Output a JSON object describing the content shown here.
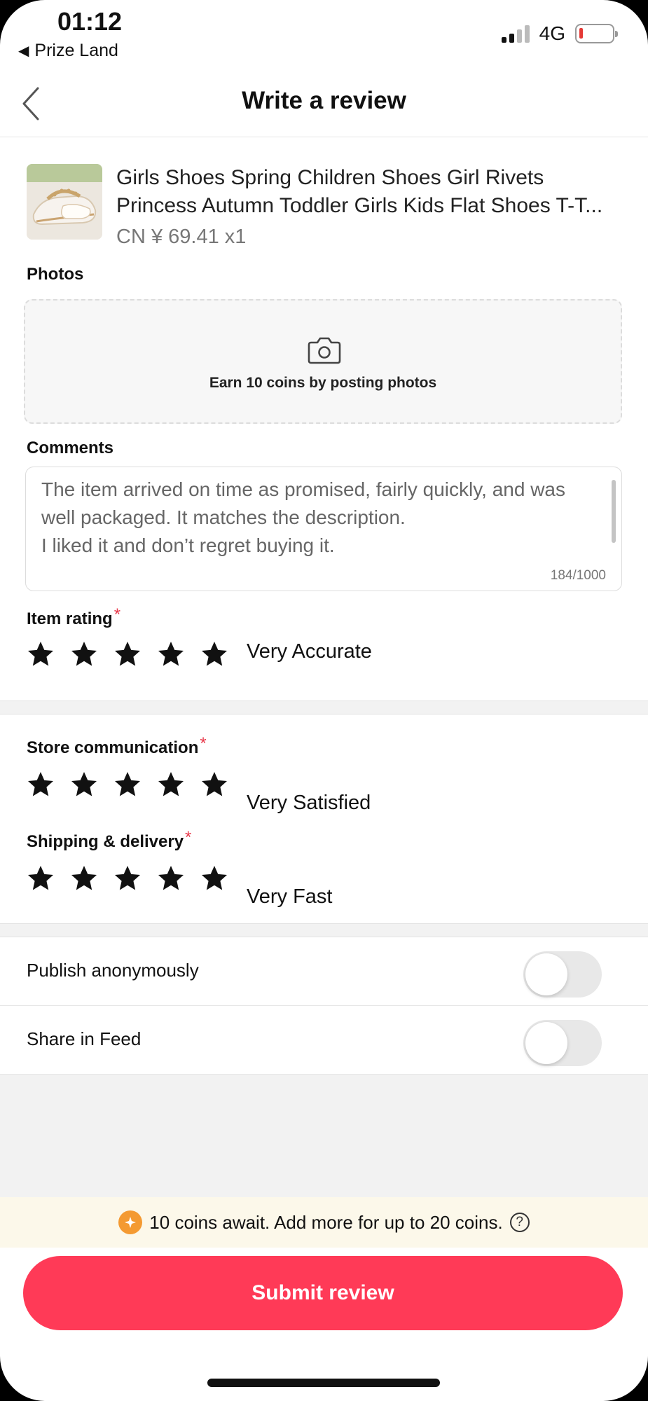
{
  "status_bar": {
    "time": "01:12",
    "back_app": "Prize Land",
    "network": "4G"
  },
  "nav": {
    "title": "Write a review",
    "back_icon": "chevron-left-icon"
  },
  "product": {
    "title_line1": "Girls Shoes Spring Children Shoes Girl Rivets",
    "title_line2": "Princess Autumn Toddler Girls Kids Flat Shoes T-T...",
    "price": "CN ¥  69.41 x1"
  },
  "photos": {
    "label": "Photos",
    "hint": "Earn 10 coins by posting photos",
    "icon": "camera-icon"
  },
  "comments": {
    "label": "Comments",
    "text": "The item arrived on time as promised, fairly quickly, and was well packaged. It matches the description.\nI liked it and don’t regret buying it.",
    "count": "184/1000"
  },
  "item_rating": {
    "label": "Item rating",
    "required_mark": "*",
    "stars": 5,
    "text": "Very Accurate"
  },
  "store_communication": {
    "label": "Store communication",
    "required_mark": "*",
    "stars": 5,
    "text": "Very Satisfied"
  },
  "shipping_delivery": {
    "label": "Shipping & delivery",
    "required_mark": "*",
    "stars": 5,
    "text": "Very Fast"
  },
  "toggles": {
    "anonymous_label": "Publish anonymously",
    "anonymous_on": false,
    "feed_label": "Share in Feed",
    "feed_on": false
  },
  "coins": {
    "text": "10 coins await. Add more for up to 20 coins.",
    "help_symbol": "?"
  },
  "submit": {
    "label": "Submit review"
  },
  "colors": {
    "accent": "#ff3a57",
    "required": "#e8394b",
    "coin": "#f49a32",
    "banner_bg": "#fcf8ea"
  }
}
